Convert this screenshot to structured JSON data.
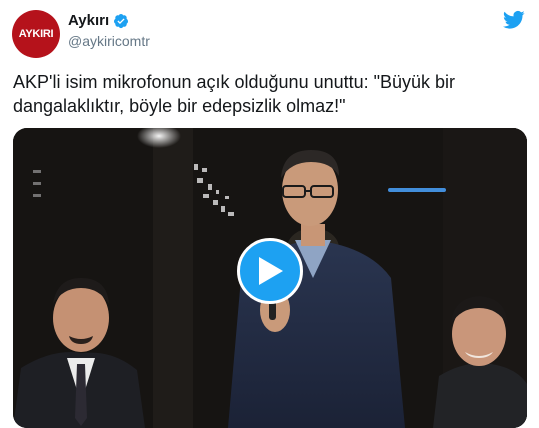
{
  "account": {
    "display_name": "Aykırı",
    "handle": "@aykiricomtr",
    "avatar_text": "AYKIRI",
    "verified": true
  },
  "tweet": {
    "text": "AKP'li isim mikrofonun açık olduğunu unuttu: \"Büyük bir dangalaklıktır, böyle bir edepsizlik olmaz!\""
  },
  "icons": {
    "verified": "verified-badge-icon",
    "logo": "twitter-bird-icon",
    "play": "play-icon"
  },
  "colors": {
    "brand_blue": "#1da1f2",
    "avatar_red": "#b5121b",
    "text_primary": "#14171a",
    "text_secondary": "#657786"
  }
}
